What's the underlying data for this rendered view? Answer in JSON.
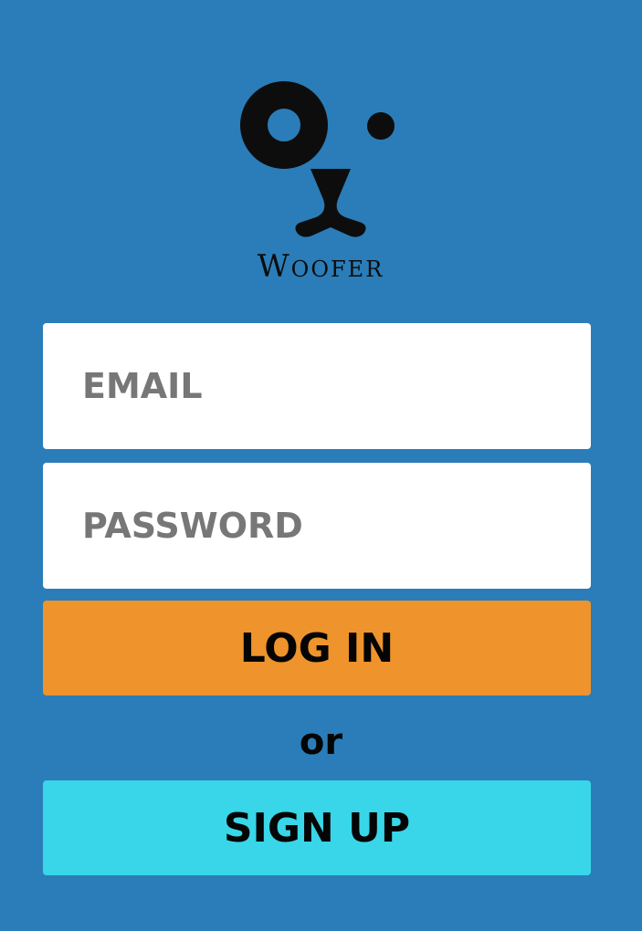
{
  "brand": {
    "name": "Woofer",
    "logo_icon": "dog-face-icon"
  },
  "form": {
    "email_placeholder": "EMAIL",
    "password_placeholder": "PASSWORD",
    "login_label": "LOG IN",
    "or_label": "or",
    "signup_label": "SIGN UP"
  },
  "colors": {
    "background": "#2a7db8",
    "login_button": "#ef932c",
    "signup_button": "#38d6e8",
    "field_background": "#ffffff",
    "placeholder_text": "#777777"
  }
}
